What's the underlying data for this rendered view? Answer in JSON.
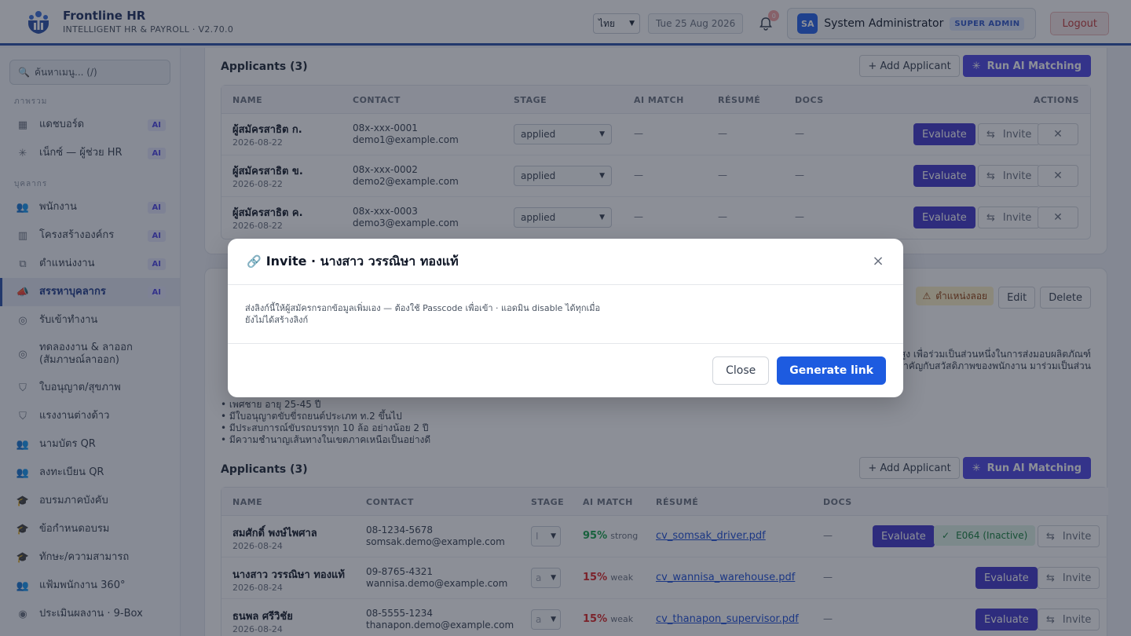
{
  "header": {
    "brand_name": "Frontline HR",
    "brand_sub": "INTELLIGENT HR & PAYROLL · V2.70.0",
    "language": "ไทย",
    "date": "Tue 25 Aug 2026",
    "notif_count": "0",
    "user_initials": "SA",
    "user_name": "System Administrator",
    "user_role": "SUPER ADMIN",
    "logout_label": "Logout"
  },
  "sidebar": {
    "search_placeholder": "ค้นหาเมนู... (/)",
    "sections": [
      "ภาพรวม",
      "บุคลากร"
    ],
    "items": [
      {
        "label": "แดชบอร์ด",
        "badge": "AI",
        "icon": "grid-icon"
      },
      {
        "label": "เน็กซ์ — ผู้ช่วย HR",
        "badge": "AI",
        "icon": "sparkle-icon"
      },
      {
        "label": "พนักงาน",
        "badge": "AI",
        "icon": "users-icon"
      },
      {
        "label": "โครงสร้างองค์กร",
        "badge": "AI",
        "icon": "building-icon"
      },
      {
        "label": "ตำแหน่งงาน",
        "badge": "AI",
        "icon": "sitemap-icon"
      },
      {
        "label": "สรรหาบุคลากร",
        "badge": "AI",
        "icon": "megaphone-icon"
      },
      {
        "label": "รับเข้าทำงาน",
        "badge": "",
        "icon": "compass-icon"
      },
      {
        "label": "ทดลองงาน & ลาออก (สัมภาษณ์ลาออก)",
        "badge": "",
        "icon": "compass-icon"
      },
      {
        "label": "ใบอนุญาต/สุขภาพ",
        "badge": "",
        "icon": "shield-icon"
      },
      {
        "label": "แรงงานต่างด้าว",
        "badge": "",
        "icon": "shield-icon"
      },
      {
        "label": "นามบัตร QR",
        "badge": "",
        "icon": "users-icon"
      },
      {
        "label": "ลงทะเบียน QR",
        "badge": "",
        "icon": "users-icon"
      },
      {
        "label": "อบรมภาคบังคับ",
        "badge": "",
        "icon": "graduation-icon"
      },
      {
        "label": "ข้อกำหนดอบรม",
        "badge": "",
        "icon": "graduation-icon"
      },
      {
        "label": "ทักษะ/ความสามารถ",
        "badge": "",
        "icon": "graduation-icon"
      },
      {
        "label": "แฟ้มพนักงาน 360°",
        "badge": "",
        "icon": "users-icon"
      },
      {
        "label": "ประเมินผลงาน · 9-Box",
        "badge": "",
        "icon": "target-icon"
      }
    ]
  },
  "top_section": {
    "title": "Applicants (3)",
    "add_label": "+ Add Applicant",
    "ai_label": "Run AI Matching",
    "columns": [
      "NAME",
      "CONTACT",
      "STAGE",
      "AI MATCH",
      "RÉSUMÉ",
      "DOCS",
      "ACTIONS"
    ],
    "rows": [
      {
        "name": "ผู้สมัครสาธิต ก.",
        "date": "2026-08-22",
        "phone": "08x-xxx-0001",
        "email": "demo1@example.com",
        "stage": "applied",
        "match": "—",
        "resume": "—",
        "docs": "—"
      },
      {
        "name": "ผู้สมัครสาธิต ข.",
        "date": "2026-08-22",
        "phone": "08x-xxx-0002",
        "email": "demo2@example.com",
        "stage": "applied",
        "match": "—",
        "resume": "—",
        "docs": "—"
      },
      {
        "name": "ผู้สมัครสาธิต ค.",
        "date": "2026-08-22",
        "phone": "08x-xxx-0003",
        "email": "demo3@example.com",
        "stage": "applied",
        "match": "—",
        "resume": "—",
        "docs": "—"
      }
    ],
    "evaluate_label": "Evaluate",
    "invite_label": "Invite"
  },
  "job_card": {
    "edit_label": "Edit",
    "delete_label": "Delete",
    "warn_label": "ตำแหน่งลอย",
    "desc_right_1": "บสูง เพื่อร่วมเป็นส่วนหนึ่งในการส่งมอบผลิตภัณฑ์",
    "desc_right_2": "สำคัญกับสวัสดิภาพของพนักงาน มาร่วมเป็นส่วน",
    "requirements": [
      "• เพศชาย อายุ 25-45 ปี",
      "• มีใบอนุญาตขับขี่รถยนต์ประเภท ท.2 ขึ้นไป",
      "• มีประสบการณ์ขับรถบรรทุก 10 ล้อ อย่างน้อย 2 ปี",
      "• มีความชำนาญเส้นทางในเขตภาคเหนือเป็นอย่างดี"
    ]
  },
  "bottom_section": {
    "title": "Applicants (3)",
    "add_label": "+ Add Applicant",
    "ai_label": "Run AI Matching",
    "columns": [
      "NAME",
      "CONTACT",
      "STAGE",
      "AI MATCH",
      "RÉSUMÉ",
      "DOCS"
    ],
    "rows": [
      {
        "name": "สมศักดิ์ พงษ์ไพศาล",
        "date": "2026-08-24",
        "phone": "08-1234-5678",
        "email": "somsak.demo@example.com",
        "stage": "I",
        "match": "95%",
        "match_tag": "strong",
        "resume": "cv_somsak_driver.pdf",
        "docs": "—",
        "employee": "E064 (Inactive)"
      },
      {
        "name": "นางสาว วรรณิษา ทองแท้",
        "date": "2026-08-24",
        "phone": "09-8765-4321",
        "email": "wannisa.demo@example.com",
        "stage": "a",
        "match": "15%",
        "match_tag": "weak",
        "resume": "cv_wannisa_warehouse.pdf",
        "docs": "—"
      },
      {
        "name": "ธนพล ศรีวิชัย",
        "date": "2026-08-24",
        "phone": "08-5555-1234",
        "email": "thanapon.demo@example.com",
        "stage": "a",
        "match": "15%",
        "match_tag": "weak",
        "resume": "cv_thanapon_supervisor.pdf",
        "docs": "—"
      }
    ],
    "evaluate_label": "Evaluate",
    "invite_label": "Invite"
  },
  "modal": {
    "title": "Invite · นางสาว วรรณิษา ทองแท้",
    "description": "ส่งลิงก์นี้ให้ผู้สมัครกรอกข้อมูลเพิ่มเอง — ต้องใช้ Passcode เพื่อเข้า · แอดมิน disable ได้ทุกเมื่อ",
    "status": "ยังไม่ได้สร้างลิงก์",
    "close_label": "Close",
    "generate_label": "Generate link"
  },
  "colors": {
    "brand": "#2b50a8",
    "ai": "#4f46e5",
    "primary": "#1d5be0",
    "danger": "#c23a3a"
  }
}
